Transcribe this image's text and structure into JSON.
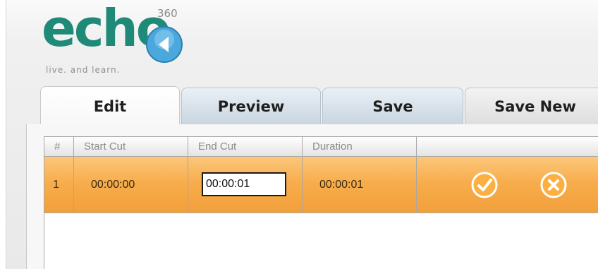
{
  "logo": {
    "word": "echo",
    "superscript": "360",
    "tagline": "live. and learn.",
    "icon": "play-icon",
    "brand_color": "#1f8a78"
  },
  "tabs": [
    {
      "label": "Edit",
      "active": true
    },
    {
      "label": "Preview",
      "active": false
    },
    {
      "label": "Save",
      "active": false
    },
    {
      "label": "Save New",
      "active": false
    }
  ],
  "table": {
    "columns": [
      "#",
      "Start Cut",
      "End Cut",
      "Duration",
      ""
    ],
    "rows": [
      {
        "index": "1",
        "start_cut": "00:00:00",
        "end_cut": "00:00:01",
        "duration": "00:00:01"
      }
    ],
    "row_highlight_color": "#f7ac4b",
    "actions": [
      {
        "icon": "checkmark-icon",
        "label": "confirm"
      },
      {
        "icon": "close-x-icon",
        "label": "cancel"
      }
    ]
  }
}
